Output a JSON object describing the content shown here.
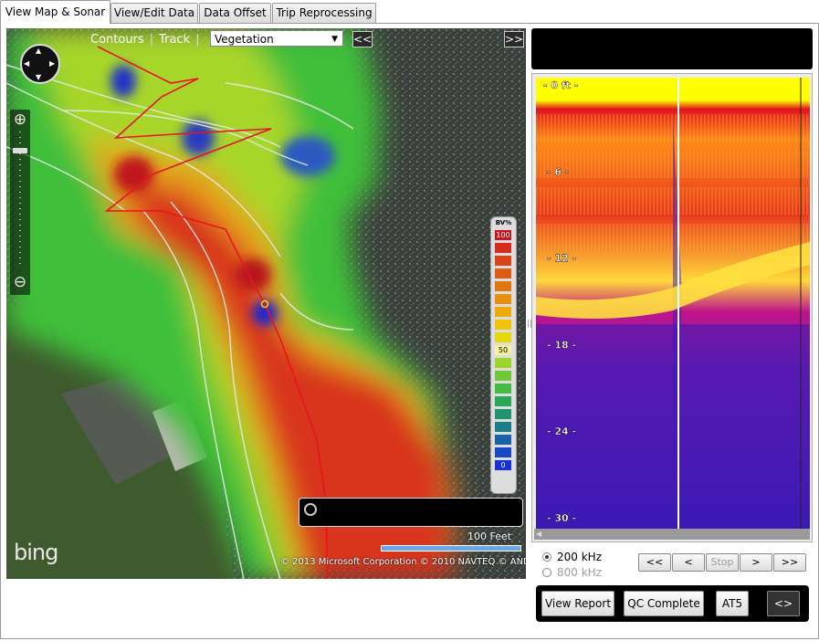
{
  "tabs": [
    {
      "label": "View Map & Sonar",
      "active": true
    },
    {
      "label": "View/Edit Data",
      "active": false
    },
    {
      "label": "Data Offset",
      "active": false
    },
    {
      "label": "Trip Reprocessing",
      "active": false
    }
  ],
  "map": {
    "toolbar": {
      "contours_label": "Contours",
      "separator": "|",
      "track_label": "Track",
      "layer_select_value": "Vegetation",
      "collapse_left_label": "<<",
      "expand_right_label": ">>"
    },
    "legend": {
      "title": "BV%",
      "labels": [
        "100",
        "50",
        "0"
      ],
      "colors": [
        "#c8141e",
        "#d42b1c",
        "#d84418",
        "#dc5c14",
        "#e07512",
        "#e8900f",
        "#eeaa0d",
        "#efc40b",
        "#e6d80a",
        "#c8dd18",
        "#9ed52a",
        "#6fc938",
        "#45bb46",
        "#2aa85a",
        "#1f936f",
        "#1c7d8a",
        "#1a62a8",
        "#1846c4",
        "#1830dc"
      ]
    },
    "scale_text": "100 Feet",
    "brand": "bing",
    "copyright": "© 2013 Microsoft Corporation   © 2010 NAVTEQ   © AND",
    "icons": [
      "pan-navigation-icon",
      "zoom-in-icon",
      "zoom-out-icon",
      "search-magnifier-icon"
    ]
  },
  "sonar": {
    "depth_labels": [
      "0 ft",
      "6",
      "12",
      "18",
      "24",
      "30"
    ],
    "frequency_options": [
      {
        "label": "200 kHz",
        "selected": true
      },
      {
        "label": "800 kHz",
        "selected": false
      }
    ],
    "playback_buttons": [
      {
        "label": "<<",
        "enabled": true
      },
      {
        "label": "<",
        "enabled": true
      },
      {
        "label": "Stop",
        "enabled": false
      },
      {
        "label": ">",
        "enabled": true
      },
      {
        "label": ">>",
        "enabled": true
      }
    ],
    "actions": {
      "view_report": "View Report",
      "qc_complete": "QC Complete",
      "at5": "AT5",
      "toggle_layout_icon": "<>"
    }
  },
  "colors": {
    "track_line": "#e8141e",
    "scale_bar": "#6aa6e8",
    "sonar_surface": "#ffff00",
    "sonar_background": "#3c1ab4"
  }
}
